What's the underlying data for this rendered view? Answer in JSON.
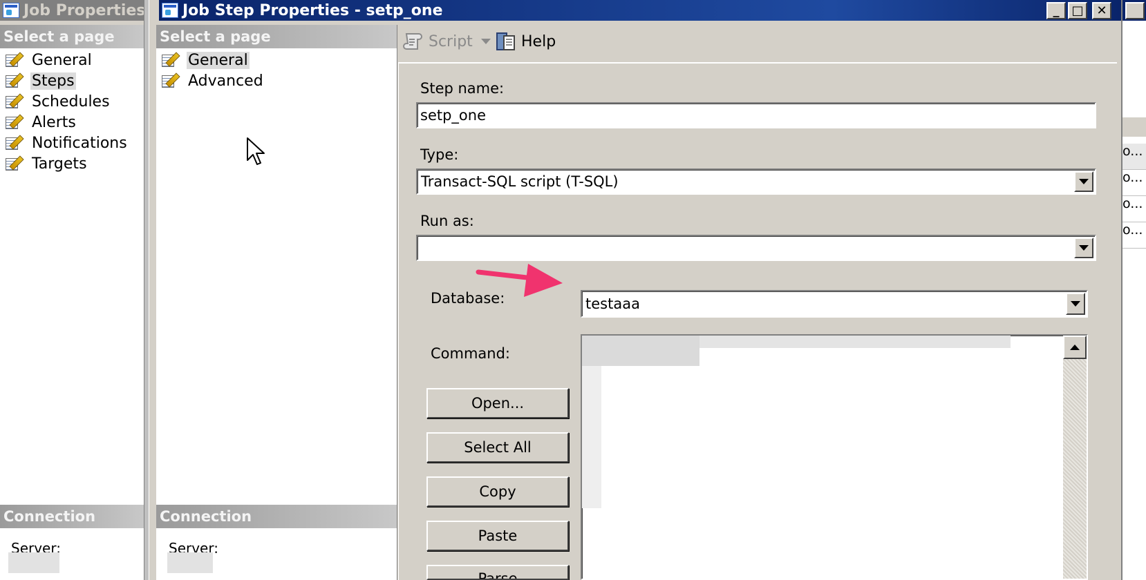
{
  "job_window": {
    "title": "Job Properties -",
    "select_page_header": "Select a page",
    "pages": [
      {
        "label": "General",
        "selected": false
      },
      {
        "label": "Steps",
        "selected": true
      },
      {
        "label": "Schedules",
        "selected": false
      },
      {
        "label": "Alerts",
        "selected": false
      },
      {
        "label": "Notifications",
        "selected": false
      },
      {
        "label": "Targets",
        "selected": false
      }
    ],
    "connection_header": "Connection",
    "server_label": "Server:"
  },
  "step_window": {
    "title": "Job Step Properties - setp_one",
    "select_page_header": "Select a page",
    "pages": [
      {
        "label": "General",
        "selected": true
      },
      {
        "label": "Advanced",
        "selected": false
      }
    ],
    "connection_header": "Connection",
    "server_label": "Server:",
    "toolbar": {
      "script_label": "Script",
      "help_label": "Help"
    },
    "form": {
      "step_name_label": "Step name:",
      "step_name_value": "setp_one",
      "type_label": "Type:",
      "type_value": "Transact-SQL script (T-SQL)",
      "run_as_label": "Run as:",
      "run_as_value": "",
      "database_label": "Database:",
      "database_value": "testaaa",
      "command_label": "Command:",
      "buttons": {
        "open": "Open...",
        "select_all": "Select All",
        "copy": "Copy",
        "paste": "Paste",
        "parse": "Parse"
      }
    },
    "caption_buttons": {
      "minimize": "_",
      "maximize": "□",
      "close": "✕"
    }
  },
  "background_list": {
    "cells": [
      "o...",
      "o...",
      "o...",
      "o..."
    ]
  },
  "colors": {
    "title_active": "#0a246a",
    "title_inactive": "#808080",
    "dialog_face": "#d4d0c8",
    "arrow": "#f0336e"
  }
}
